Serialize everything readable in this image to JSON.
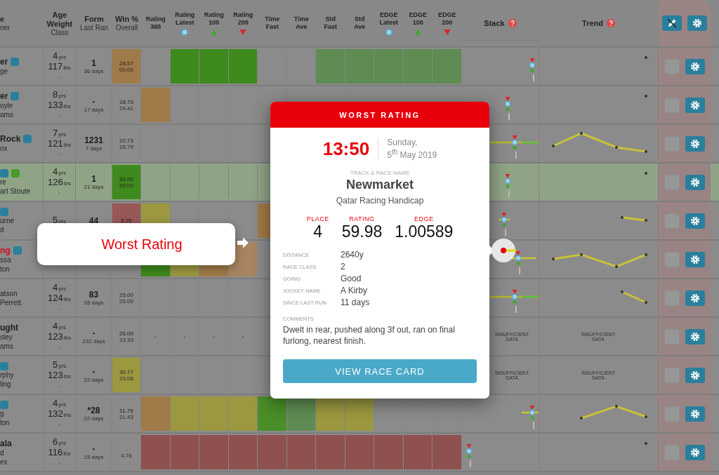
{
  "header": {
    "columns": [
      {
        "kind": "text",
        "lines": [
          "e"
        ],
        "sub": "ner"
      },
      {
        "kind": "text",
        "lines": [
          "Age",
          "Weight"
        ],
        "sub": "Class"
      },
      {
        "kind": "text",
        "lines": [
          "Form"
        ],
        "sub": "Last Ran"
      },
      {
        "kind": "text",
        "lines": [
          "Win %"
        ],
        "sub": "Overall"
      },
      {
        "kind": "text",
        "lines": [
          "Rating",
          "365"
        ]
      },
      {
        "kind": "text",
        "lines": [
          "Rating",
          "Latest"
        ],
        "marker": {
          "kind": "circle"
        }
      },
      {
        "kind": "text",
        "lines": [
          "Rating",
          "100"
        ],
        "marker": {
          "kind": "up"
        }
      },
      {
        "kind": "text",
        "lines": [
          "Rating",
          "200"
        ],
        "marker": {
          "kind": "down"
        }
      },
      {
        "kind": "text",
        "lines": [
          "Time",
          "Fast"
        ]
      },
      {
        "kind": "text",
        "lines": [
          "Time",
          "Ave"
        ]
      },
      {
        "kind": "text",
        "lines": [
          "Std",
          "Fast"
        ]
      },
      {
        "kind": "text",
        "lines": [
          "Std",
          "Ave"
        ]
      },
      {
        "kind": "text",
        "lines": [
          "EDGE",
          "Latest"
        ],
        "marker": {
          "kind": "circle"
        }
      },
      {
        "kind": "text",
        "lines": [
          "EDGE",
          "100"
        ],
        "marker": {
          "kind": "up"
        }
      },
      {
        "kind": "text",
        "lines": [
          "EDGE",
          "200"
        ],
        "marker": {
          "kind": "down"
        }
      },
      {
        "kind": "chart",
        "lines": [
          "Stack"
        ]
      },
      {
        "kind": "chart",
        "lines": [
          "Trend"
        ]
      }
    ]
  },
  "rows": [
    {
      "highlighted": false,
      "name": "er",
      "alert": false,
      "badges": [
        {
          "color": "#2a7f9d"
        }
      ],
      "lines": [
        "ge"
      ],
      "age": "4",
      "age_unit": "yrs",
      "weight": "117",
      "weight_unit": "lbs",
      "class": "-",
      "form": "1",
      "last_ran": "36 days",
      "win": {
        "values": [
          "28.57",
          "00.00"
        ],
        "color": "#a07a48"
      },
      "ratings": [
        {
          "kind": "blank"
        },
        {
          "kind": "fill",
          "color": "#3f8a1c"
        },
        {
          "kind": "fill",
          "color": "#3f8a1c"
        },
        {
          "kind": "fill",
          "color": "#3f8a1c"
        },
        {
          "kind": "blank"
        },
        {
          "kind": "blank"
        },
        {
          "kind": "fill",
          "color": "#5f8c52"
        },
        {
          "kind": "fill",
          "color": "#5f8c52"
        },
        {
          "kind": "fill",
          "color": "#5f8c52"
        },
        {
          "kind": "fill",
          "color": "#5f8c52"
        },
        {
          "kind": "fill",
          "color": "#5f8c52"
        }
      ],
      "stack": {
        "kind": "vertical"
      },
      "trend": {
        "kind": "dot"
      },
      "checked": false
    },
    {
      "highlighted": false,
      "name": "er",
      "alert": false,
      "badges": [
        {
          "color": "#2a7f9d"
        }
      ],
      "lines": [
        "oyle",
        "ams"
      ],
      "age": "8",
      "age_unit": "yrs",
      "weight": "133",
      "weight_unit": "lbs",
      "class": "-",
      "form": "-",
      "last_ran": "17 days",
      "win": {
        "values": [
          "18.75",
          "29.41"
        ]
      },
      "ratings": [
        {
          "kind": "fill",
          "color": "#a07a48"
        },
        {
          "kind": "blank"
        },
        {
          "kind": "blank"
        },
        {
          "kind": "blank"
        },
        {
          "kind": "blank"
        },
        {
          "kind": "blank"
        },
        {
          "kind": "blank"
        },
        {
          "kind": "blank"
        },
        {
          "kind": "blank"
        },
        {
          "kind": "blank"
        },
        {
          "kind": "blank"
        }
      ],
      "stack": {
        "kind": "vertical-left"
      },
      "trend": {
        "kind": "dot"
      },
      "checked": false
    },
    {
      "highlighted": false,
      "name": "Rock",
      "alert": false,
      "badges": [
        {
          "color": "#2a7f9d"
        }
      ],
      "lines": [
        "ox"
      ],
      "age": "7",
      "age_unit": "yrs",
      "weight": "121",
      "weight_unit": "lbs",
      "class": "-",
      "form": "1231",
      "last_ran": "7 days",
      "win": {
        "values": [
          "22.73",
          "15.79"
        ]
      },
      "ratings": [
        {
          "kind": "blank"
        },
        {
          "kind": "blank"
        },
        {
          "kind": "blank"
        },
        {
          "kind": "blank"
        },
        {
          "kind": "blank"
        },
        {
          "kind": "blank"
        },
        {
          "kind": "blank"
        },
        {
          "kind": "blank"
        },
        {
          "kind": "blank"
        },
        {
          "kind": "blank"
        },
        {
          "kind": "blank"
        }
      ],
      "stack": {
        "kind": "bar"
      },
      "trend": {
        "kind": "peak"
      },
      "checked": false
    },
    {
      "highlighted": true,
      "badges": [
        {
          "color": "#2a7f9d"
        },
        {
          "color": "#4a9a2a"
        }
      ],
      "lines": [
        "re",
        "art Stoute"
      ],
      "age": "4",
      "age_unit": "yrs",
      "weight": "126",
      "weight_unit": "lbs",
      "class": "-",
      "form": "1",
      "last_ran": "21 days",
      "win": {
        "values": [
          "50.00",
          "50.00"
        ],
        "color": "#3f8a1c"
      },
      "ratings": [
        {
          "kind": "blank"
        },
        {
          "kind": "blank"
        },
        {
          "kind": "blank"
        },
        {
          "kind": "blank"
        },
        {
          "kind": "blank"
        },
        {
          "kind": "blank"
        },
        {
          "kind": "blank"
        },
        {
          "kind": "blank"
        },
        {
          "kind": "blank"
        },
        {
          "kind": "blank"
        },
        {
          "kind": "blank"
        }
      ],
      "stack": {
        "kind": "vertical-left"
      },
      "trend": {
        "kind": "dot"
      },
      "checked": false
    },
    {
      "highlighted": false,
      "badges": [
        {
          "color": "#2a7f9d"
        }
      ],
      "lines": [
        "urne",
        "d"
      ],
      "age": "5",
      "age_unit": "yrs",
      "form": "44",
      "win": {
        "values": [
          "6.25"
        ],
        "color": "#985858"
      },
      "ratings": [
        {
          "kind": "fill",
          "color": "#9b9840"
        },
        {
          "kind": "blank"
        },
        {
          "kind": "blank"
        },
        {
          "kind": "blank"
        },
        {
          "kind": "fill",
          "color": "#a07a48"
        },
        {
          "kind": "blank"
        },
        {
          "kind": "blank"
        },
        {
          "kind": "blank"
        },
        {
          "kind": "blank"
        },
        {
          "kind": "blank"
        },
        {
          "kind": "blank"
        }
      ],
      "stack": {
        "kind": "cluster"
      },
      "trend": {
        "kind": "short-fall"
      },
      "checked": false
    },
    {
      "highlighted": false,
      "name": "ng",
      "alert": true,
      "badges": [
        {
          "color": "#2a7f9d"
        }
      ],
      "lines": [
        "ssa",
        "ton"
      ],
      "ratings": [
        {
          "kind": "fill",
          "color": "#3f8a1c"
        },
        {
          "kind": "fill",
          "color": "#9b9840"
        },
        {
          "kind": "fill",
          "color": "#a07a48"
        },
        {
          "kind": "fill",
          "color": "#a88560"
        },
        {
          "kind": "blank"
        },
        {
          "kind": "blank"
        },
        {
          "kind": "blank"
        },
        {
          "kind": "blank"
        },
        {
          "kind": "blank"
        },
        {
          "kind": "blank"
        },
        {
          "kind": "blank"
        }
      ],
      "stack": {
        "kind": "bar-right"
      },
      "trend": {
        "kind": "zigzag"
      },
      "checked": false
    },
    {
      "highlighted": false,
      "badges": [],
      "lines": [
        "atson",
        "Perrett"
      ],
      "age": "4",
      "age_unit": "yrs",
      "weight": "124",
      "weight_unit": "lbs",
      "class": "-",
      "form": "83",
      "last_ran": "28 days",
      "win": {
        "values": [
          "25.00",
          "25.00"
        ]
      },
      "ratings": [
        {
          "kind": "blank"
        },
        {
          "kind": "blank"
        },
        {
          "kind": "blank"
        },
        {
          "kind": "blank"
        },
        {
          "kind": "blank"
        },
        {
          "kind": "blank"
        },
        {
          "kind": "blank"
        },
        {
          "kind": "blank"
        },
        {
          "kind": "blank"
        },
        {
          "kind": "blank"
        },
        {
          "kind": "blank"
        }
      ],
      "stack": {
        "kind": "bar"
      },
      "trend": {
        "kind": "fall"
      },
      "checked": false
    },
    {
      "highlighted": false,
      "name": "ught",
      "alert": false,
      "badges": [],
      "lines": [
        "sley",
        "ams"
      ],
      "age": "4",
      "age_unit": "yrs",
      "weight": "123",
      "weight_unit": "lbs",
      "class": "-",
      "form": "-",
      "last_ran": "232 days",
      "win": {
        "values": [
          "25.00",
          "33.33"
        ]
      },
      "ratings": [
        {
          "kind": "dash",
          "text": "-"
        },
        {
          "kind": "dash",
          "text": "-"
        },
        {
          "kind": "dash",
          "text": "-"
        },
        {
          "kind": "dash",
          "text": "-"
        },
        {
          "kind": "blank"
        },
        {
          "kind": "blank"
        },
        {
          "kind": "blank"
        },
        {
          "kind": "blank"
        },
        {
          "kind": "blank"
        },
        {
          "kind": "blank"
        },
        {
          "kind": "blank"
        }
      ],
      "stack": {
        "kind": "insufficient",
        "text": "INSUFFICIENT DATA"
      },
      "trend": {
        "kind": "insufficient",
        "text": "INSUFFICIENT DATA"
      },
      "checked": false
    },
    {
      "highlighted": false,
      "badges": [
        {
          "color": "#2a7f9d"
        }
      ],
      "lines": [
        "rphy",
        "ling"
      ],
      "age": "5",
      "age_unit": "yrs",
      "weight": "123",
      "weight_unit": "lbs",
      "class": "-",
      "form": "-",
      "last_ran": "22 days",
      "win": {
        "values": [
          "30.77",
          "23.08"
        ],
        "color": "#9b9840"
      },
      "ratings": [
        {
          "kind": "blank"
        },
        {
          "kind": "blank"
        },
        {
          "kind": "blank"
        },
        {
          "kind": "blank"
        },
        {
          "kind": "blank"
        },
        {
          "kind": "blank"
        },
        {
          "kind": "blank"
        },
        {
          "kind": "blank"
        },
        {
          "kind": "blank"
        },
        {
          "kind": "blank"
        },
        {
          "kind": "blank"
        }
      ],
      "stack": {
        "kind": "insufficient",
        "text": "INSUFFICIENT DATA"
      },
      "trend": {
        "kind": "insufficient",
        "text": "INSUFFICIENT DATA"
      },
      "checked": false
    },
    {
      "highlighted": false,
      "badges": [
        {
          "color": "#2a7f9d"
        }
      ],
      "lines": [
        "g",
        "ton"
      ],
      "age": "4",
      "age_unit": "yrs",
      "weight": "132",
      "weight_unit": "lbs",
      "class": "-",
      "form": "*28",
      "last_ran": "22 days",
      "win": {
        "values": [
          "11.76",
          "21.43"
        ]
      },
      "ratings": [
        {
          "kind": "fill",
          "color": "#a07a48"
        },
        {
          "kind": "fill",
          "color": "#9b9840"
        },
        {
          "kind": "fill",
          "color": "#9b9840"
        },
        {
          "kind": "fill",
          "color": "#9b9840"
        },
        {
          "kind": "fill",
          "color": "#4a8e28"
        },
        {
          "kind": "fill",
          "color": "#5f8c52"
        },
        {
          "kind": "fill",
          "color": "#9b9840"
        },
        {
          "kind": "fill",
          "color": "#9b9840"
        },
        {
          "kind": "blank"
        },
        {
          "kind": "blank"
        },
        {
          "kind": "blank"
        }
      ],
      "stack": {
        "kind": "bar-far"
      },
      "trend": {
        "kind": "rise-fall"
      },
      "checked": false
    },
    {
      "highlighted": false,
      "name": "ala",
      "alert": false,
      "badges": [],
      "lines": [
        "d",
        "ex"
      ],
      "age": "6",
      "age_unit": "yrs",
      "weight": "116",
      "weight_unit": "lbs",
      "class": "-",
      "form": "-",
      "last_ran": "15 days",
      "win": {
        "values": [
          "-",
          "4.76"
        ]
      },
      "ratings": [
        {
          "kind": "fill",
          "color": "#8f5050"
        },
        {
          "kind": "fill",
          "color": "#8f5050"
        },
        {
          "kind": "fill",
          "color": "#8f5050"
        },
        {
          "kind": "fill",
          "color": "#8f5050"
        },
        {
          "kind": "fill",
          "color": "#8f5050"
        },
        {
          "kind": "fill",
          "color": "#8f5050"
        },
        {
          "kind": "fill",
          "color": "#8f5050"
        },
        {
          "kind": "fill",
          "color": "#8f5050"
        },
        {
          "kind": "fill",
          "color": "#8f5050"
        },
        {
          "kind": "fill",
          "color": "#8f5050"
        },
        {
          "kind": "fill",
          "color": "#8f5050"
        }
      ],
      "stack": {
        "kind": "vertical-start"
      },
      "trend": {
        "kind": "dot"
      },
      "checked": false
    }
  ],
  "callout": {
    "text": "Worst Rating"
  },
  "popup": {
    "title": "WORST RATING",
    "time": "13:50",
    "day": "Sunday,",
    "date": "5$^{th}$ May 2019",
    "track_label": "TRACK & RACE NAME",
    "track": "Newmarket",
    "race": "Qatar Racing Handicap",
    "stats": [
      {
        "label": "PLACE",
        "value": "4"
      },
      {
        "label": "RATING",
        "value": "59.98"
      },
      {
        "label": "EDGE",
        "value": "1.00589"
      }
    ],
    "details": [
      {
        "label": "DISTANCE",
        "value": "2640y"
      },
      {
        "label": "RACE CLASS",
        "value": "2"
      },
      {
        "label": "GOING",
        "value": "Good"
      },
      {
        "label": "JOCKEY NAME",
        "value": "A Kirby"
      },
      {
        "label": "SINCE LAST RUN",
        "value": "11 days"
      }
    ],
    "comments_label": "COMMENTS",
    "comments": "Dwelt in rear, pushed along 3f out, ran on final furlong, nearest finish.",
    "button": "VIEW RACE CARD"
  }
}
